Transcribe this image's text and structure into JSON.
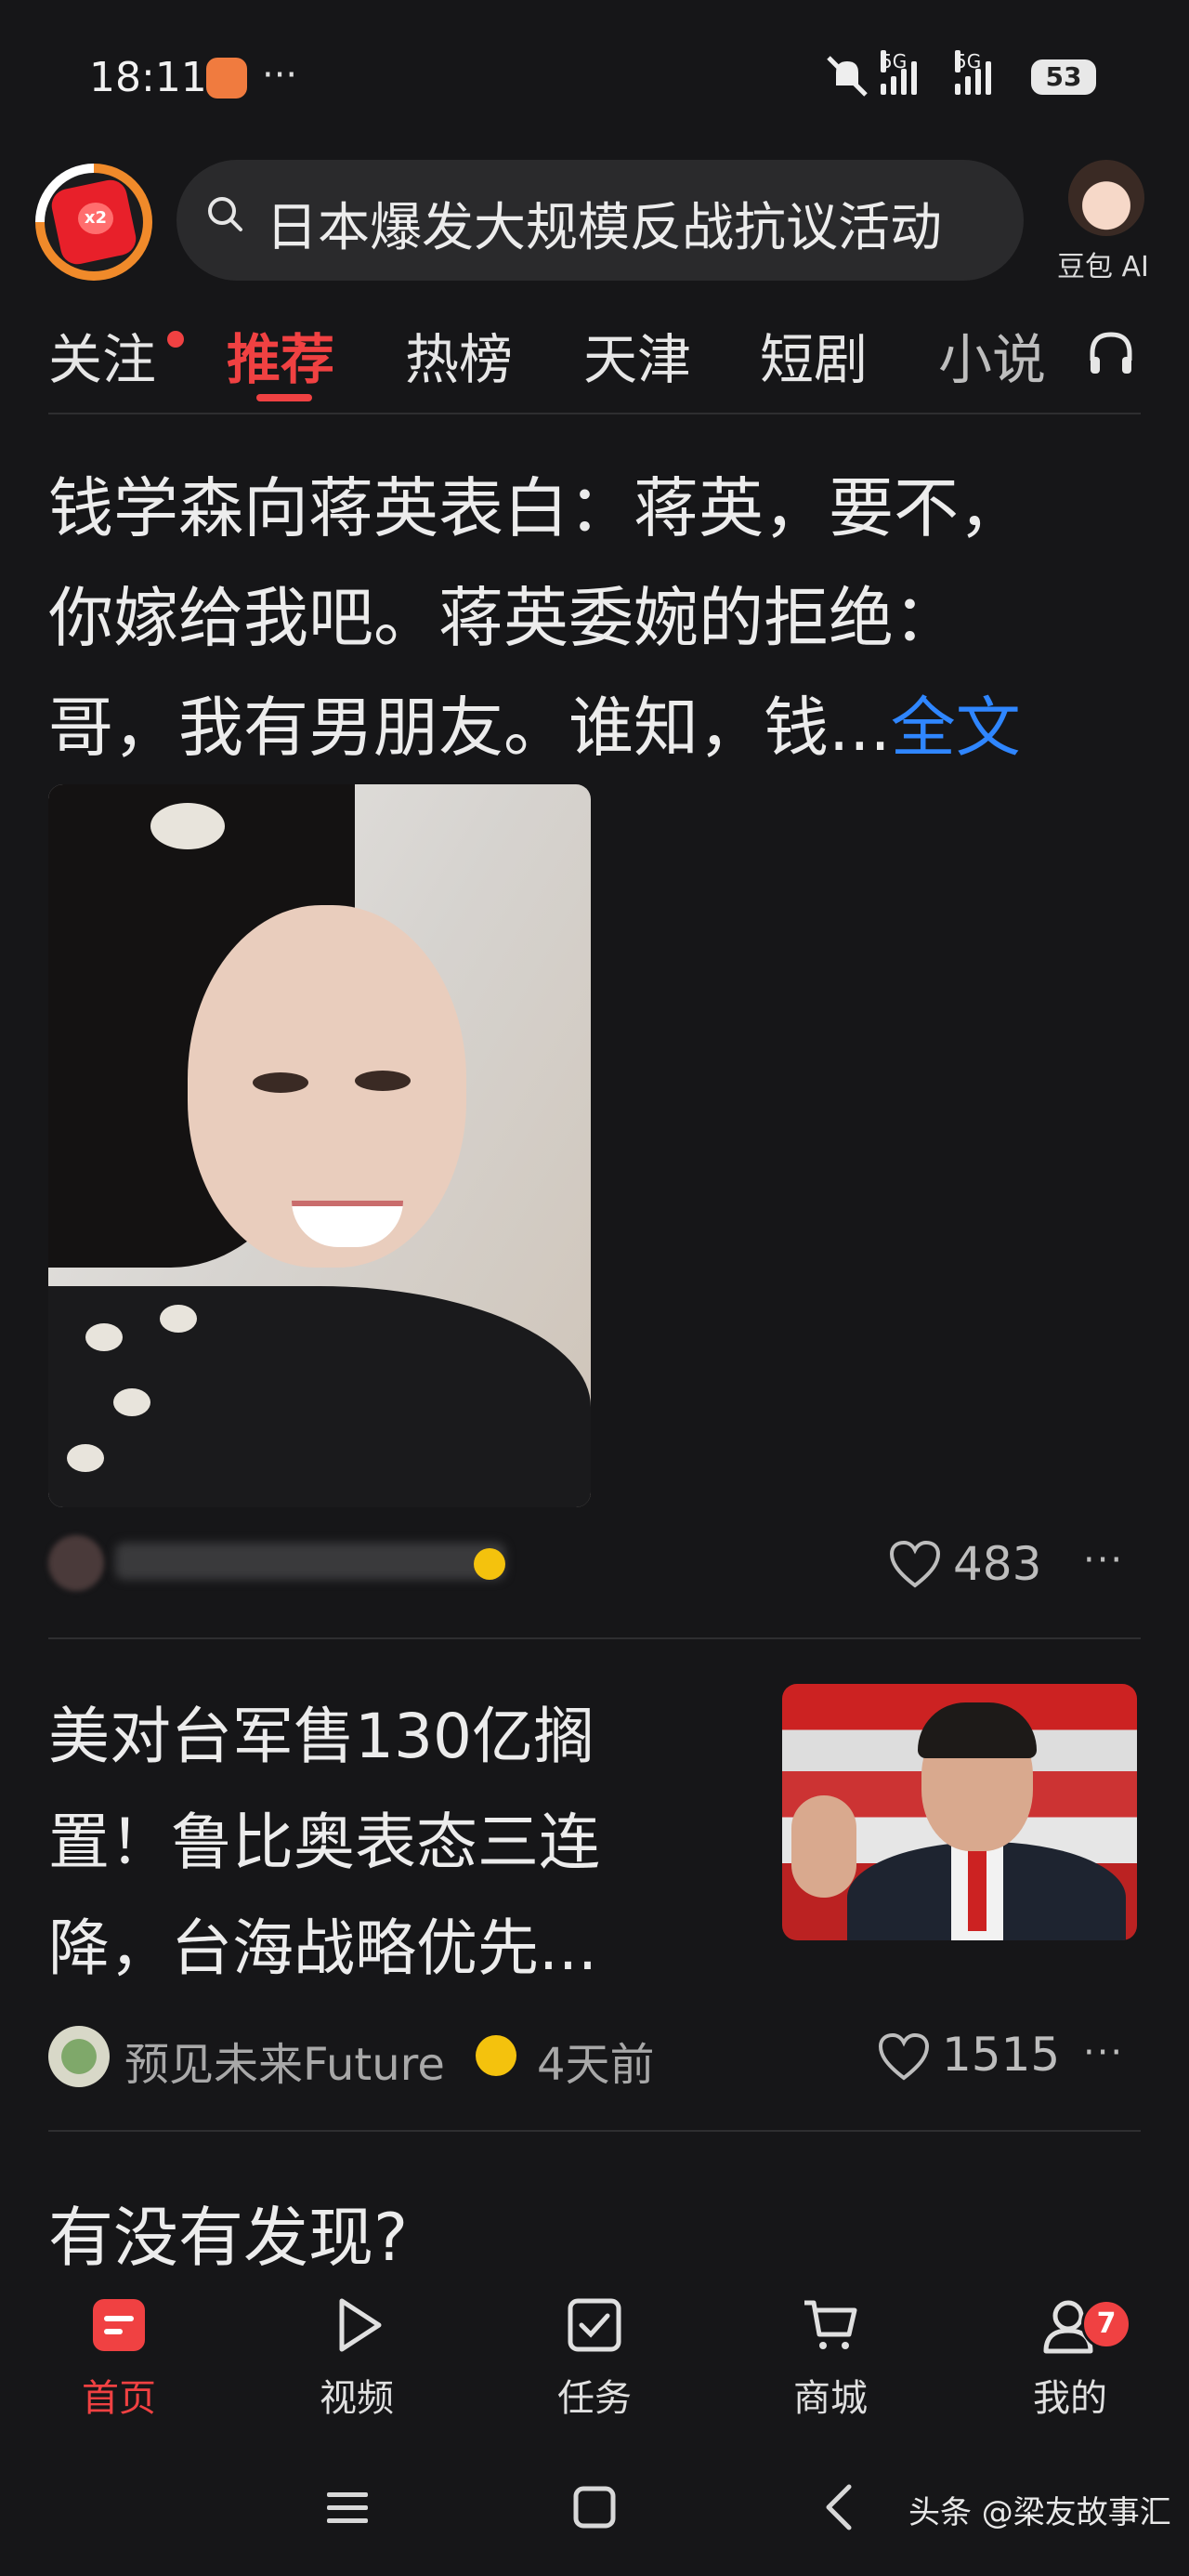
{
  "status_bar": {
    "time": "18:11",
    "dots": "···",
    "network_1": "5G",
    "network_2": "5G",
    "battery": "53"
  },
  "header": {
    "logo_badge": "x2",
    "search_text": "日本爆发大规模反战抗议活动",
    "ai_label": "豆包 AI"
  },
  "tabs": [
    {
      "label": "关注",
      "active": false
    },
    {
      "label": "推荐",
      "active": true
    },
    {
      "label": "热榜",
      "active": false
    },
    {
      "label": "天津",
      "active": false
    },
    {
      "label": "短剧",
      "active": false
    },
    {
      "label": "小说",
      "active": false
    }
  ],
  "article1": {
    "line1": "钱学森向蒋英表白：蒋英，要不，",
    "line2": "你嫁给我吧。蒋英委婉的拒绝：",
    "line3": "哥，我有男朋友。谁知，钱...",
    "more": "全文",
    "likes": "483"
  },
  "article2": {
    "line1": "美对台军售130亿搁",
    "line2": "置！鲁比奥表态三连",
    "line3": "降，台海战略优先...",
    "source": "预见未来Future",
    "time": "4天前",
    "likes": "1515"
  },
  "article3": {
    "title": "有没有发现?"
  },
  "bottom_nav": [
    {
      "label": "首页",
      "icon": "home-icon",
      "active": true
    },
    {
      "label": "视频",
      "icon": "play-icon",
      "active": false
    },
    {
      "label": "任务",
      "icon": "task-check-icon",
      "active": false
    },
    {
      "label": "商城",
      "icon": "cart-icon",
      "active": false
    },
    {
      "label": "我的",
      "icon": "profile-icon",
      "active": false
    }
  ],
  "profile_badge": "7",
  "watermark": "头条 @梁友故事汇",
  "colors": {
    "background": "#161618",
    "accent": "#f04142",
    "link": "#2f86ff",
    "text": "#ececec",
    "meta": "#a8a8a8"
  }
}
